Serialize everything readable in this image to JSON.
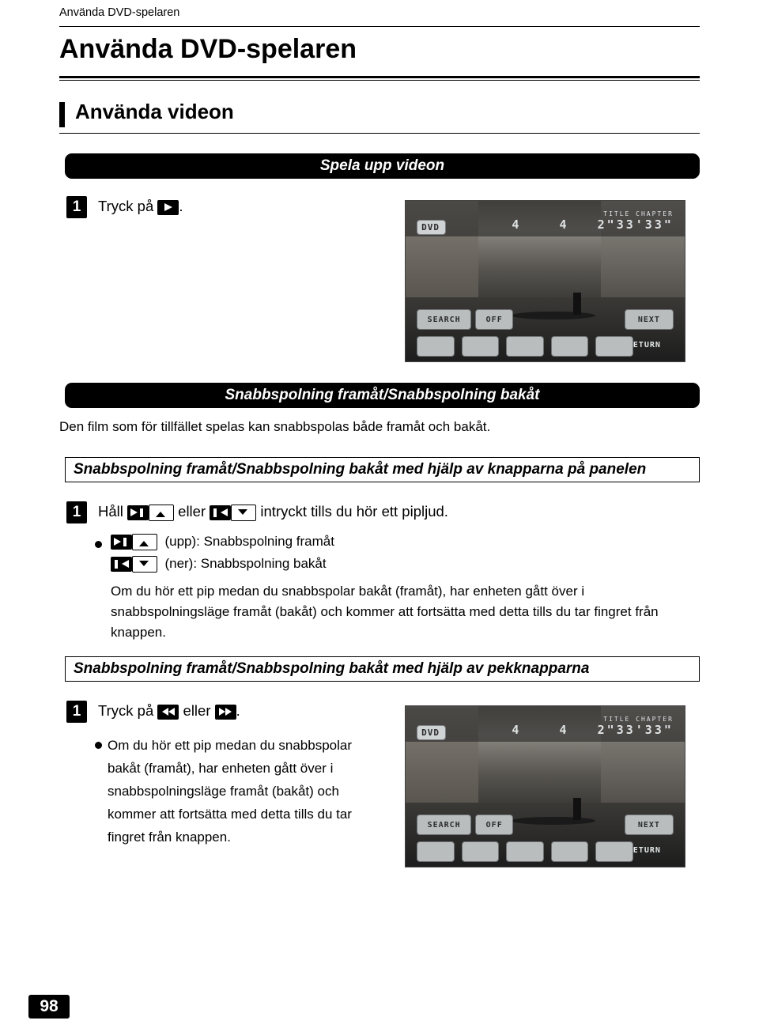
{
  "header": {
    "running_head": "Använda DVD-spelaren",
    "chapter_title": "Använda DVD-spelaren",
    "section_title": "Använda videon"
  },
  "banners": {
    "play_video": "Spela upp videon",
    "ff_rew": "Snabbspolning framåt/Snabbspolning bakåt"
  },
  "boxheads": {
    "panel_buttons": "Snabbspolning framåt/Snabbspolning bakåt med hjälp av knapparna på panelen",
    "touch_buttons": "Snabbspolning framåt/Snabbspolning bakåt med hjälp av pekknapparna"
  },
  "steps": {
    "num": "1",
    "play_prefix": "Tryck på",
    "play_suffix": ".",
    "hold_prefix": "Håll",
    "hold_or": "eller",
    "hold_suffix": "intryckt tills du hör ett pipljud.",
    "touch_prefix": "Tryck på",
    "touch_or": "eller",
    "touch_suffix": "."
  },
  "body": {
    "intro_ff": "Den film som för tillfället spelas kan snabbspolas både framåt och bakåt.",
    "up_label": "(upp): Snabbspolning framåt",
    "down_label": "(ner): Snabbspolning bakåt",
    "note_panel": "Om du hör ett pip medan du snabbspolar bakåt (framåt), har enheten gått över i snabbspolningsläge framåt (bakåt) och kommer att fortsätta med detta tills du tar fingret från knappen.",
    "note_touch": "Om du hör ett pip medan du snabbspolar bakåt (framåt), har enheten gått över i snabbspolningsläge framåt (bakåt) och kommer att fortsätta med detta tills du tar fingret från knappen."
  },
  "dvd_screen": {
    "badge": "DVD",
    "info_row1": "TITLE        CHAPTER",
    "title_value": "4",
    "chapter_value": "4",
    "time_value": "2\"33'33\"",
    "btn_search": "SEARCH",
    "btn_off": "OFF",
    "btn_next": "NEXT",
    "btn_return": "RETURN"
  },
  "footer": {
    "page_number": "98"
  },
  "colors": {
    "ink": "#000000",
    "paper": "#ffffff",
    "banner_bg": "#000000",
    "banner_text": "#ffffff"
  }
}
